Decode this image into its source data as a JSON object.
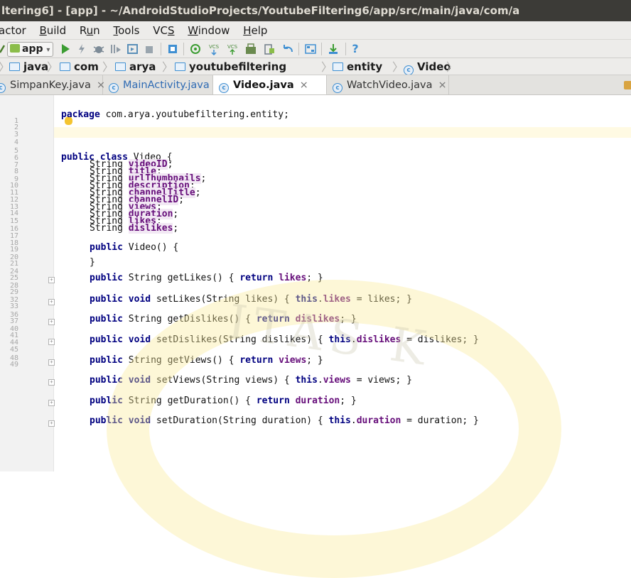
{
  "window": {
    "title": "ltering6] - [app] - ~/AndroidStudioProjects/YoutubeFiltering6/app/src/main/java/com/a"
  },
  "menu": {
    "items": [
      {
        "pre": "",
        "ul": "",
        "post": "actor"
      },
      {
        "pre": "",
        "ul": "B",
        "post": "uild"
      },
      {
        "pre": "R",
        "ul": "u",
        "post": "n"
      },
      {
        "pre": "",
        "ul": "T",
        "post": "ools"
      },
      {
        "pre": "VC",
        "ul": "S",
        "post": ""
      },
      {
        "pre": "",
        "ul": "W",
        "post": "indow"
      },
      {
        "pre": "",
        "ul": "H",
        "post": "elp"
      }
    ]
  },
  "toolbar": {
    "run_config": "app",
    "help_glyph": "?"
  },
  "breadcrumbs": {
    "items": [
      "java",
      "com",
      "arya",
      "youtubefiltering",
      "entity",
      "Video"
    ]
  },
  "tabs": [
    {
      "label": "SimpanKey.java",
      "close": "×"
    },
    {
      "label": "MainActivity.java",
      "close": "×"
    },
    {
      "label": "Video.java",
      "close": "×"
    },
    {
      "label": "WatchVideo.java",
      "close": "×"
    }
  ],
  "gutter_numbers": [
    "1",
    "2",
    "3",
    "4",
    "5",
    "6",
    "7",
    "8",
    "9",
    "10",
    "11",
    "12",
    "13",
    "14",
    "15",
    "16",
    "17",
    "18",
    "19",
    "20",
    "21",
    "24",
    "25",
    "28",
    "29",
    "32",
    "33",
    "36",
    "37",
    "40",
    "41",
    "44",
    "45",
    "48",
    "49"
  ],
  "code": {
    "package_kw": "package",
    "package_name": " com.arya.youtubefiltering.entity;",
    "class_kw": "public class",
    "class_name": " Video {",
    "string_type": "String ",
    "fields": [
      "videoID",
      "title",
      "urlThumbnails",
      "description",
      "channelTitle",
      "channelID",
      "views",
      "duration",
      "likes",
      "dislikes"
    ],
    "semicolon": ";",
    "ctor_kw": "public",
    "ctor_rest": " Video() {",
    "close_brace": "}",
    "methods": [
      {
        "kw": "public",
        "sig": " String getLikes() { ",
        "ret": "return",
        "body1": " ",
        "fld": "likes",
        "body2": "; }"
      },
      {
        "kw": "public void",
        "sig": " setLikes(String likes) { ",
        "ret": "this",
        "body1": ".",
        "fld": "likes",
        "body2": " = likes; }"
      },
      {
        "kw": "public",
        "sig": " String getDislikes() { ",
        "ret": "return",
        "body1": " ",
        "fld": "dislikes",
        "body2": "; }"
      },
      {
        "kw": "public void",
        "sig": " setDislikes(String dislikes) { ",
        "ret": "this",
        "body1": ".",
        "fld": "dislikes",
        "body2": " = dislikes; }"
      },
      {
        "kw": "public",
        "sig": " String getViews() { ",
        "ret": "return",
        "body1": " ",
        "fld": "views",
        "body2": "; }"
      },
      {
        "kw": "public void",
        "sig": " setViews(String views) { ",
        "ret": "this",
        "body1": ".",
        "fld": "views",
        "body2": " = views; }"
      },
      {
        "kw": "public",
        "sig": " String getDuration() { ",
        "ret": "return",
        "body1": " ",
        "fld": "duration",
        "body2": "; }"
      },
      {
        "kw": "public void",
        "sig": " setDuration(String duration) { ",
        "ret": "this",
        "body1": ".",
        "fld": "duration",
        "body2": " = duration; }"
      }
    ]
  },
  "watermark": {
    "text": "ITAS K"
  },
  "colors": {
    "keyword": "#000080",
    "field": "#660e7a",
    "titlebar": "#3c3b37",
    "accent_blue": "#3f8fd2"
  }
}
